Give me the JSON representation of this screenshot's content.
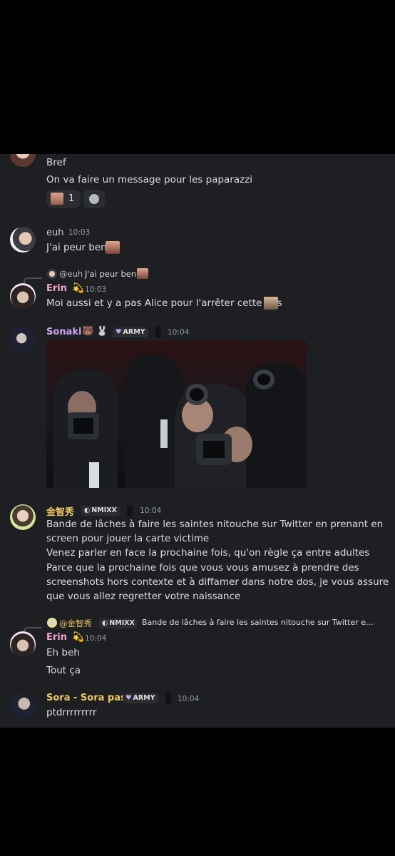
{
  "colors": {
    "background": "#1e1f22",
    "erin": "#f2a3ce",
    "sonaki": "#c9a5f5",
    "jisoo": "#f0c75e",
    "sora": "#f0c75e",
    "euh": "#c8ccd2"
  },
  "messages": {
    "m0": {
      "line1": "Bref",
      "line2": "On va faire un message pour les paparazzi",
      "reaction_count": "1"
    },
    "m1": {
      "author": "euh",
      "time": "10:03",
      "text": "J'ai peur ben"
    },
    "m2": {
      "reply_author": "@euh",
      "reply_text": "J'ai peur ben",
      "author": "Erin",
      "author_emoji": "💫",
      "time": "10:03",
      "text": "Moi aussi et y a pas Alice pour l'arrêter cette fois"
    },
    "m3": {
      "author": "Sonaki",
      "author_emojis": "🐻 🐰",
      "tag": "ARMY",
      "time": "10:04"
    },
    "m4": {
      "author": "金智秀",
      "tag": "NMIXX",
      "time": "10:04",
      "lines": [
        "Bande de lâches à faire les saintes nitouche sur Twitter en prenant en",
        "screen pour jouer la carte victime",
        "Venez parler en face la prochaine fois, qu'on règle ça entre adultes",
        "Parce que la prochaine fois que vous vous amusez à prendre des",
        "screenshots hors contexte et à diffamer dans notre dos, je vous assure",
        "que vous allez regretter votre naissance"
      ]
    },
    "m5": {
      "reply_author": "@金智秀",
      "reply_tag": "NMIXX",
      "reply_text": "Bande de lâches à faire les saintes nitouche sur Twitter e...",
      "author": "Erin",
      "author_emoji": "💫",
      "time": "10:04",
      "line1": "Eh beh",
      "line2": "Tout ça"
    },
    "m6": {
      "author": "Sora - Sora pas",
      "tag": "ARMY",
      "time": "10:04",
      "text": "ptdrrrrrrrrr"
    }
  }
}
